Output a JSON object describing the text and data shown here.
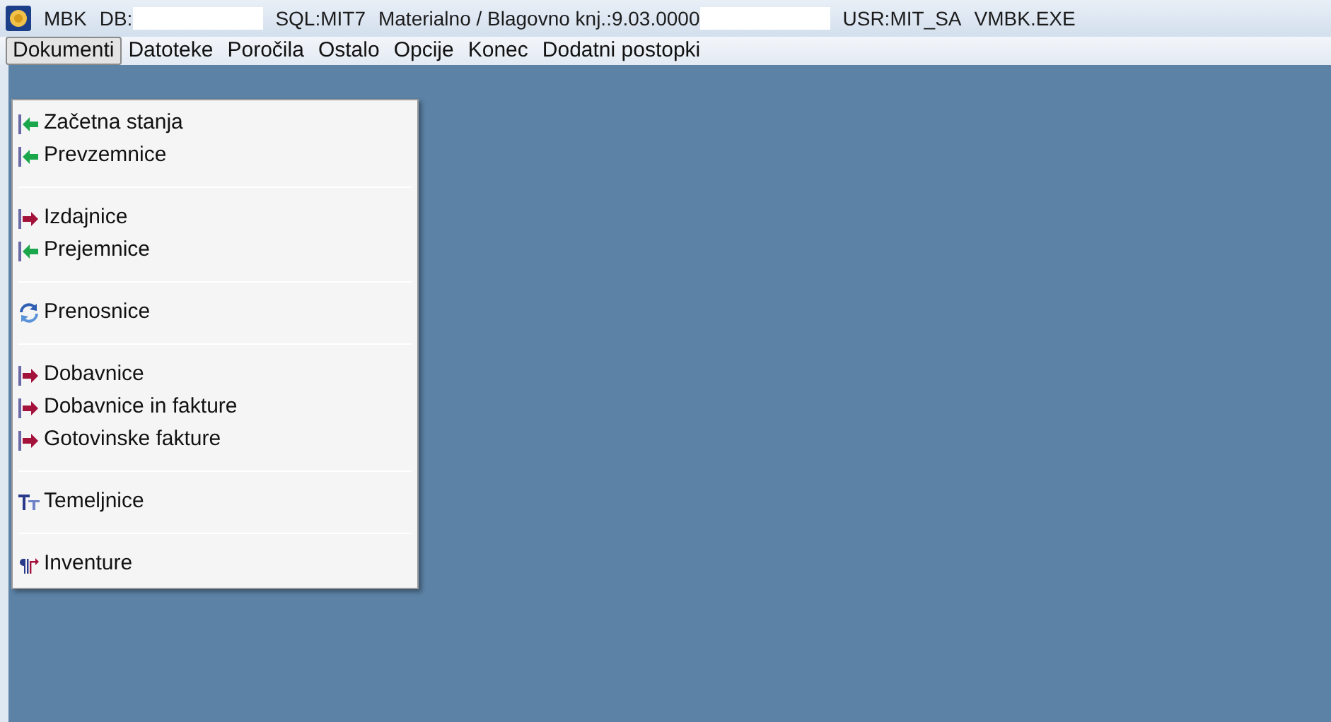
{
  "window": {
    "title_parts": [
      {
        "kind": "text",
        "text": "MBK"
      },
      {
        "kind": "text",
        "text": "DB:"
      },
      {
        "kind": "redacted"
      },
      {
        "kind": "text",
        "text": "SQL:MIT7"
      },
      {
        "kind": "text",
        "text": "Materialno / Blagovno knj.:9.03.0000"
      },
      {
        "kind": "redacted"
      },
      {
        "kind": "text",
        "text": "USR:MIT_SA"
      },
      {
        "kind": "text",
        "text": "VMBK.EXE"
      }
    ]
  },
  "menu_bar": [
    {
      "label": "Dokumenti",
      "selected": true
    },
    {
      "label": "Datoteke",
      "selected": false
    },
    {
      "label": "Poročila",
      "selected": false
    },
    {
      "label": "Ostalo",
      "selected": false
    },
    {
      "label": "Opcije",
      "selected": false
    },
    {
      "label": "Konec",
      "selected": false
    },
    {
      "label": "Dodatni postopki",
      "selected": false
    }
  ],
  "dropdown": [
    {
      "kind": "in",
      "label": "Začetna stanja"
    },
    {
      "kind": "in",
      "label": "Prevzemnice"
    },
    {
      "kind": "separator"
    },
    {
      "kind": "out",
      "label": "Izdajnice"
    },
    {
      "kind": "in",
      "label": "Prejemnice"
    },
    {
      "kind": "separator"
    },
    {
      "kind": "transfer",
      "label": "Prenosnice"
    },
    {
      "kind": "separator"
    },
    {
      "kind": "out",
      "label": "Dobavnice"
    },
    {
      "kind": "out",
      "label": "Dobavnice in fakture"
    },
    {
      "kind": "out",
      "label": "Gotovinske fakture"
    },
    {
      "kind": "separator"
    },
    {
      "kind": "text",
      "label": "Temeljnice"
    },
    {
      "kind": "separator"
    },
    {
      "kind": "inventory",
      "label": "Inventure"
    }
  ]
}
